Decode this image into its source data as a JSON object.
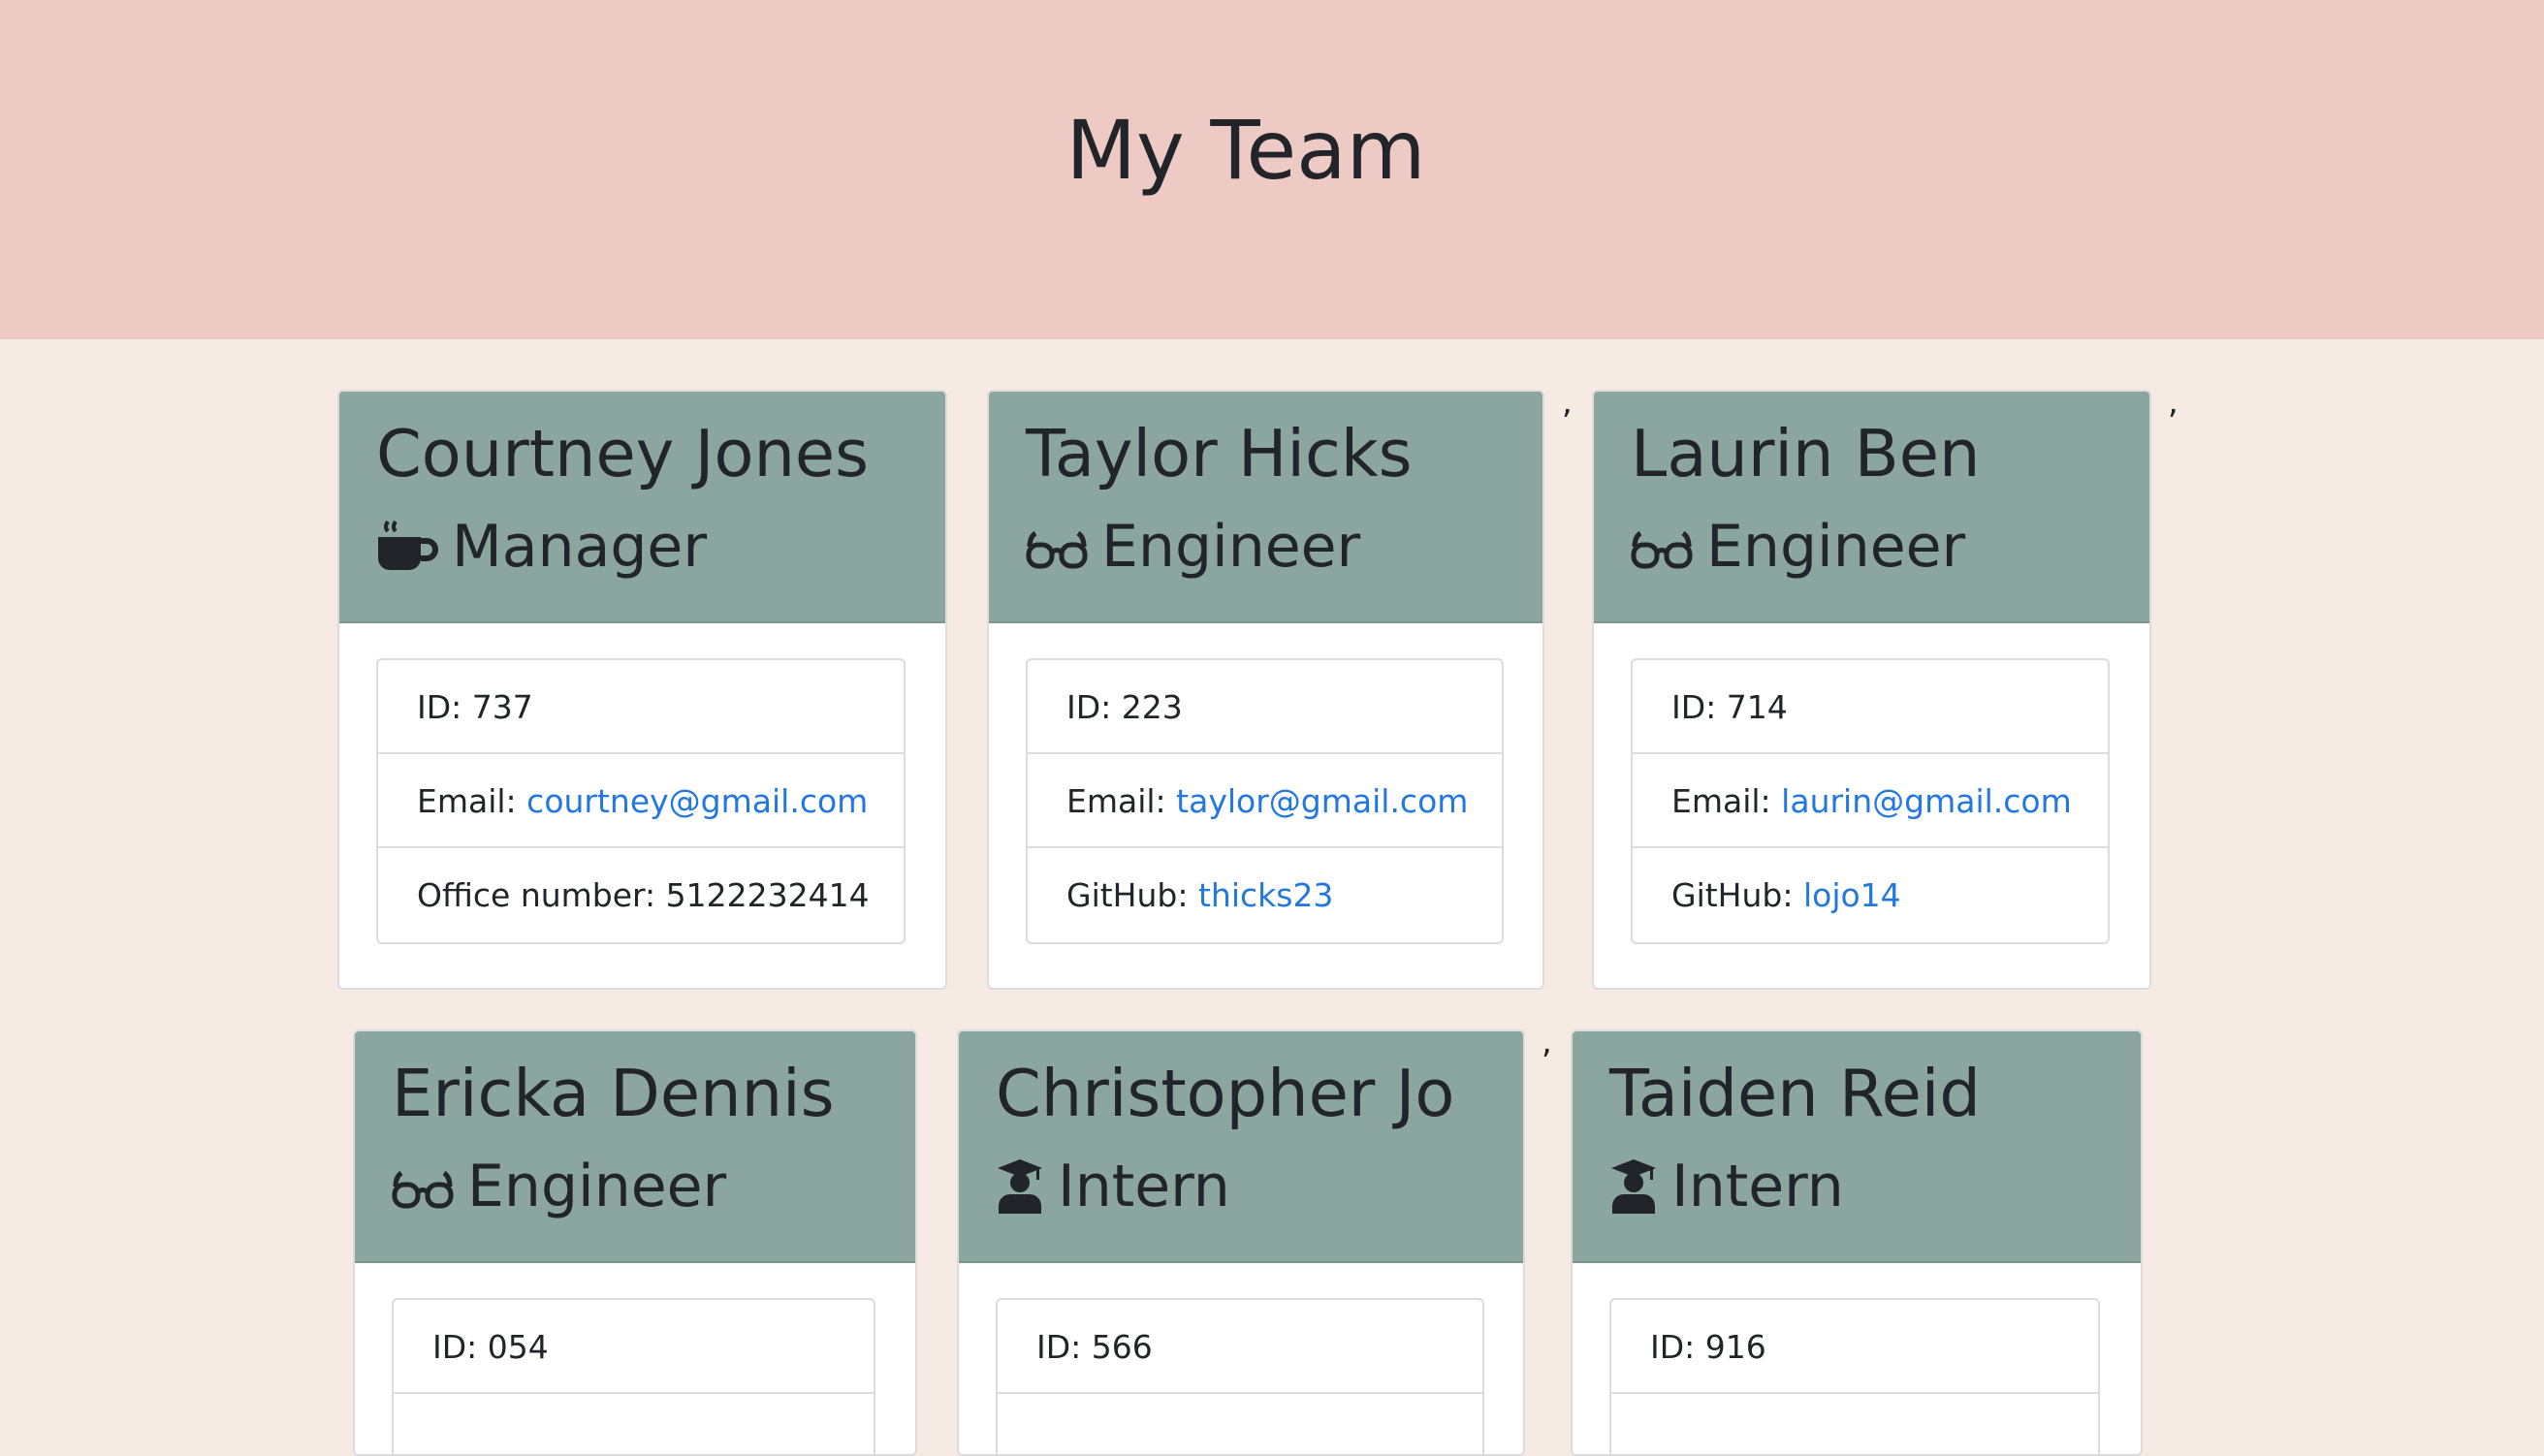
{
  "header": {
    "title": "My Team"
  },
  "team": [
    {
      "name": "Courtney Jones",
      "role": "Manager",
      "icon": "mug-icon",
      "id_label": "ID: 737",
      "email_prefix": "Email: ",
      "email": "courtney@gmail.com",
      "extra_prefix": "Office number: 5122232414",
      "extra_value": ""
    },
    {
      "name": "Taylor Hicks",
      "role": "Engineer",
      "icon": "glasses-icon",
      "id_label": "ID: 223",
      "email_prefix": "Email: ",
      "email": "taylor@gmail.com",
      "extra_prefix": "GitHub: ",
      "extra_value": "thicks23"
    },
    {
      "name": "Laurin Ben",
      "role": "Engineer",
      "icon": "glasses-icon",
      "id_label": "ID: 714",
      "email_prefix": "Email: ",
      "email": "laurin@gmail.com",
      "extra_prefix": "GitHub: ",
      "extra_value": "lojo14"
    },
    {
      "name": "Ericka Dennis",
      "role": "Engineer",
      "icon": "glasses-icon",
      "id_label": "ID: 054"
    },
    {
      "name": "Christopher Jo",
      "role": "Intern",
      "icon": "graduate-icon",
      "id_label": "ID: 566"
    },
    {
      "name": "Taiden Reid",
      "role": "Intern",
      "icon": "graduate-icon",
      "id_label": "ID: 916"
    }
  ],
  "separator": ","
}
